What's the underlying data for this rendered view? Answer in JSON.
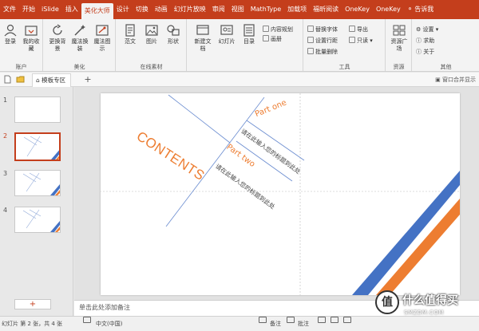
{
  "tabs": [
    {
      "label": "文件",
      "active": false
    },
    {
      "label": "开始",
      "active": false
    },
    {
      "label": "iSlide",
      "active": false
    },
    {
      "label": "插入",
      "active": false
    },
    {
      "label": "美化大师",
      "active": true
    },
    {
      "label": "设计",
      "active": false
    },
    {
      "label": "切换",
      "active": false
    },
    {
      "label": "动画",
      "active": false
    },
    {
      "label": "幻灯片放映",
      "active": false
    },
    {
      "label": "审阅",
      "active": false
    },
    {
      "label": "视图",
      "active": false
    },
    {
      "label": "MathType",
      "active": false
    },
    {
      "label": "加载项",
      "active": false
    },
    {
      "label": "福昕阅读",
      "active": false
    },
    {
      "label": "OneKey",
      "active": false
    },
    {
      "label": "OneKey",
      "active": false
    }
  ],
  "tell_me": "告诉我",
  "ribbon": {
    "account": {
      "label": "账户",
      "login": "登录",
      "favorites": "我的收藏"
    },
    "beautify": {
      "label": "美化",
      "change_bg": "更换背景",
      "magic_change": "魔法换装",
      "magic_show": "魔法图示"
    },
    "online": {
      "label": "在线素材",
      "template": "范文",
      "picture": "图片",
      "shape": "形状"
    },
    "new": {
      "new_doc": "新建文档",
      "slide": "幻灯片",
      "toc": "目录",
      "content_plan": "内容规划",
      "album": "画册"
    },
    "tools": {
      "label": "工具",
      "replace_font": "替换字体",
      "set_line_spacing": "设置行距",
      "batch_delete": "批量删除",
      "export": "导出",
      "only": "只读"
    },
    "resources": {
      "label": "资源",
      "square": "资源广场"
    },
    "other": {
      "label": "其他",
      "settings": "设置",
      "help": "求助",
      "about": "关于"
    }
  },
  "docstrip": {
    "tab_label": "模板专区",
    "new_tab": "+",
    "merge_window": "窗口合并显示"
  },
  "thumbnails": [
    {
      "num": "1",
      "selected": false
    },
    {
      "num": "2",
      "selected": true
    },
    {
      "num": "3",
      "selected": false
    },
    {
      "num": "4",
      "selected": false
    }
  ],
  "add_slide": "+",
  "slide": {
    "contents": "CONTENTS",
    "part1_title": "Part one",
    "part1_body": "请在此输入您的标题到此处",
    "part2_title": "Part two",
    "part2_body": "请在此输入您的标题到此处"
  },
  "colors": {
    "accent_red": "#c43e1c",
    "orange": "#ed7d31",
    "blue": "#4472c4"
  },
  "notes_placeholder": "单击此处添加备注",
  "status": {
    "slide_info": "幻灯片 第 2 张，共 4 张",
    "language": "中文(中国)",
    "notes_btn": "备注",
    "comments_btn": "批注"
  },
  "watermark": {
    "logo_char": "值",
    "text": "什么值得买",
    "sub": "SMZDM.COM"
  }
}
